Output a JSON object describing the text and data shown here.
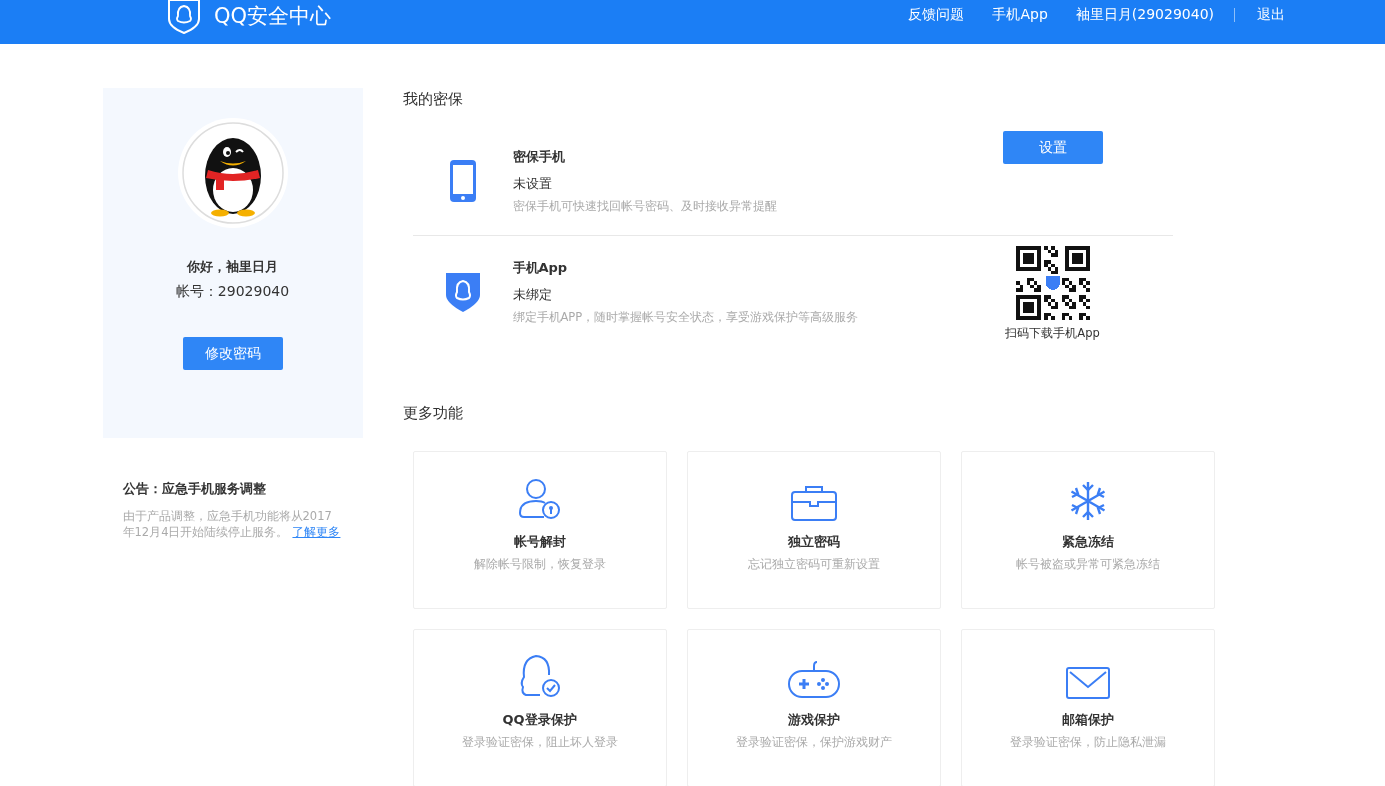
{
  "header": {
    "logo_text": "QQ安全中心",
    "nav": [
      "反馈问题",
      "手机App",
      "袖里日月(29029040)",
      "退出"
    ]
  },
  "profile": {
    "greeting": "你好，袖里日月",
    "account": "帐号：29029040",
    "button": "修改密码"
  },
  "notice": {
    "title": "公告：应急手机服务调整",
    "text": "由于产品调整，应急手机功能将从2017年12月4日开始陆续停止服务。",
    "link": "了解更多"
  },
  "security": {
    "title": "我的密保",
    "items": [
      {
        "kind": "phone",
        "name": "密保手机",
        "status": "未设置",
        "desc": "密保手机可快速找回帐号密码、及时接收异常提醒",
        "action": {
          "kind": "button",
          "label": "设置"
        }
      },
      {
        "kind": "app",
        "name": "手机App",
        "status": "未绑定",
        "desc": "绑定手机APP，随时掌握帐号安全状态，享受游戏保护等高级服务",
        "action": {
          "kind": "qr",
          "label": "扫码下载手机App"
        }
      }
    ]
  },
  "more": {
    "title": "更多功能",
    "cards": [
      {
        "kind": "unlock",
        "title": "帐号解封",
        "desc": "解除帐号限制，恢复登录"
      },
      {
        "kind": "toolbox",
        "title": "独立密码",
        "desc": "忘记独立密码可重新设置"
      },
      {
        "kind": "freeze",
        "title": "紧急冻结",
        "desc": "帐号被盗或异常可紧急冻结"
      },
      {
        "kind": "login",
        "title": "QQ登录保护",
        "desc": "登录验证密保，阻止坏人登录"
      },
      {
        "kind": "game",
        "title": "游戏保护",
        "desc": "登录验证密保，保护游戏财产"
      },
      {
        "kind": "mail",
        "title": "邮箱保护",
        "desc": "登录验证密保，防止隐私泄漏"
      }
    ]
  }
}
